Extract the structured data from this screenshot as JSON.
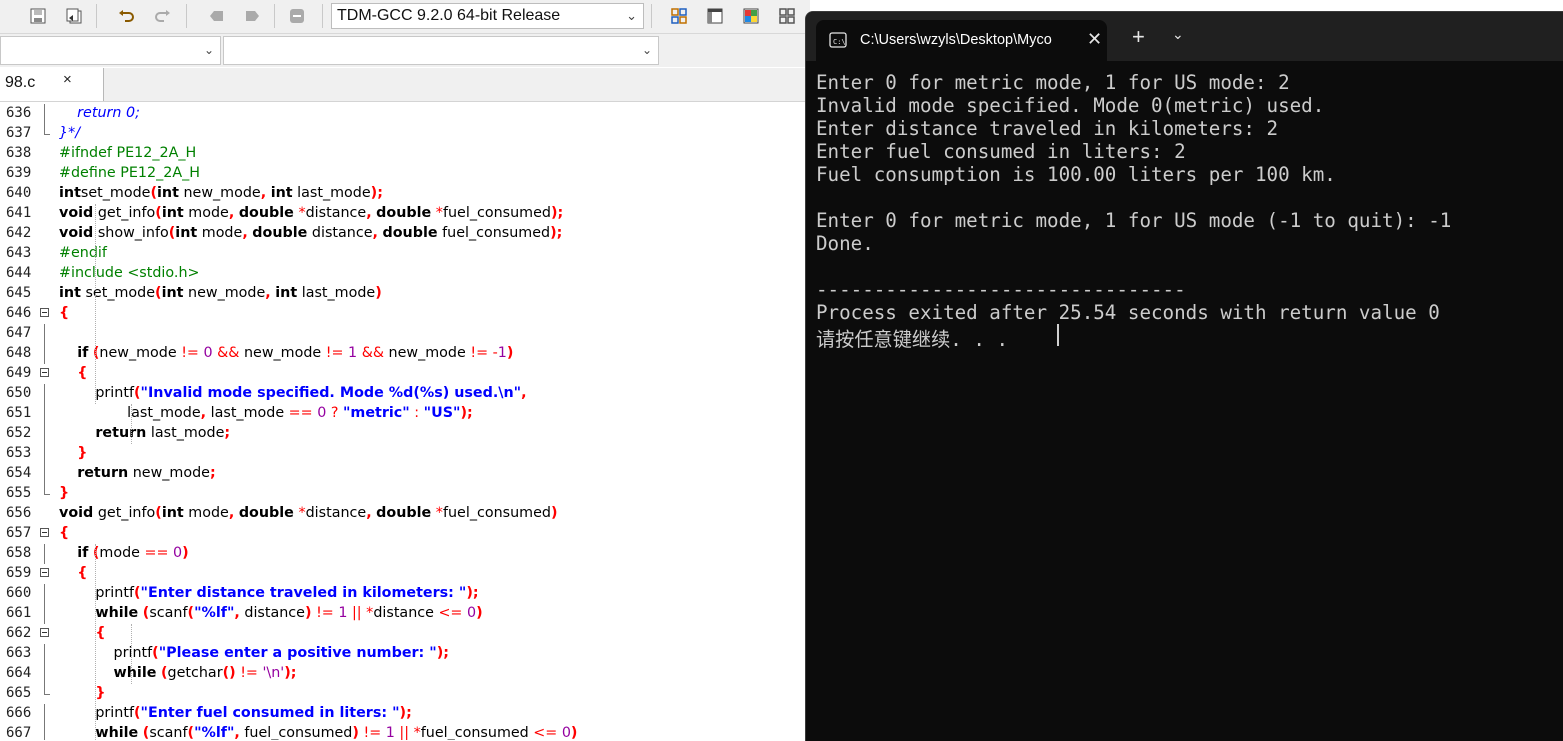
{
  "ide": {
    "compiler": "TDM-GCC 9.2.0 64-bit Release",
    "tab_label": "98.c",
    "tab_close": "×",
    "lines": [
      {
        "n": "636",
        "t": [
          [
            "cm",
            "    return 0;"
          ]
        ]
      },
      {
        "n": "637",
        "t": [
          [
            "cm",
            "}*/"
          ]
        ]
      },
      {
        "n": "638",
        "t": [
          [
            "pp",
            "#ifndef PE12_2A_H"
          ]
        ]
      },
      {
        "n": "639",
        "t": [
          [
            "pp",
            "#define PE12_2A_H"
          ]
        ]
      },
      {
        "n": "640",
        "t": [
          [
            "kw",
            "int"
          ],
          [
            "",
            "set_mode"
          ],
          [
            "sym",
            "("
          ],
          [
            "kw",
            "int"
          ],
          [
            "",
            " new_mode"
          ],
          [
            "sym",
            ","
          ],
          [
            "",
            " "
          ],
          [
            "kw",
            "int"
          ],
          [
            "",
            " last_mode"
          ],
          [
            "sym",
            ");"
          ]
        ]
      },
      {
        "n": "641",
        "t": [
          [
            "kw",
            "void"
          ],
          [
            "",
            " get_info"
          ],
          [
            "sym",
            "("
          ],
          [
            "kw",
            "int"
          ],
          [
            "",
            " mode"
          ],
          [
            "sym",
            ","
          ],
          [
            "",
            " "
          ],
          [
            "kw",
            "double"
          ],
          [
            "",
            " "
          ],
          [
            "op",
            "*"
          ],
          [
            "",
            "distance"
          ],
          [
            "sym",
            ","
          ],
          [
            "",
            " "
          ],
          [
            "kw",
            "double"
          ],
          [
            "",
            " "
          ],
          [
            "op",
            "*"
          ],
          [
            "",
            "fuel_consumed"
          ],
          [
            "sym",
            ");"
          ]
        ]
      },
      {
        "n": "642",
        "t": [
          [
            "kw",
            "void"
          ],
          [
            "",
            " show_info"
          ],
          [
            "sym",
            "("
          ],
          [
            "kw",
            "int"
          ],
          [
            "",
            " mode"
          ],
          [
            "sym",
            ","
          ],
          [
            "",
            " "
          ],
          [
            "kw",
            "double"
          ],
          [
            "",
            " distance"
          ],
          [
            "sym",
            ","
          ],
          [
            "",
            " "
          ],
          [
            "kw",
            "double"
          ],
          [
            "",
            " fuel_consumed"
          ],
          [
            "sym",
            ");"
          ]
        ]
      },
      {
        "n": "643",
        "t": [
          [
            "pp",
            "#endif"
          ]
        ]
      },
      {
        "n": "644",
        "t": [
          [
            "pp",
            "#include <stdio.h>"
          ]
        ]
      },
      {
        "n": "645",
        "t": [
          [
            "kw",
            "int"
          ],
          [
            "",
            " set_mode"
          ],
          [
            "sym",
            "("
          ],
          [
            "kw",
            "int"
          ],
          [
            "",
            " new_mode"
          ],
          [
            "sym",
            ","
          ],
          [
            "",
            " "
          ],
          [
            "kw",
            "int"
          ],
          [
            "",
            " last_mode"
          ],
          [
            "sym",
            ")"
          ]
        ]
      },
      {
        "n": "646",
        "t": [
          [
            "sym",
            "{"
          ]
        ]
      },
      {
        "n": "647",
        "t": []
      },
      {
        "n": "648",
        "t": [
          [
            "",
            "    "
          ],
          [
            "kw",
            "if"
          ],
          [
            "",
            " "
          ],
          [
            "sym",
            "("
          ],
          [
            "",
            "new_mode "
          ],
          [
            "op",
            "!="
          ],
          [
            "",
            " "
          ],
          [
            "num",
            "0"
          ],
          [
            "",
            " "
          ],
          [
            "op",
            "&&"
          ],
          [
            "",
            " new_mode "
          ],
          [
            "op",
            "!="
          ],
          [
            "",
            " "
          ],
          [
            "num",
            "1"
          ],
          [
            "",
            " "
          ],
          [
            "op",
            "&&"
          ],
          [
            "",
            " new_mode "
          ],
          [
            "op",
            "!="
          ],
          [
            "",
            " "
          ],
          [
            "op",
            "-"
          ],
          [
            "num",
            "1"
          ],
          [
            "sym",
            ")"
          ]
        ]
      },
      {
        "n": "649",
        "t": [
          [
            "",
            "    "
          ],
          [
            "sym",
            "{"
          ]
        ]
      },
      {
        "n": "650",
        "t": [
          [
            "",
            "        printf"
          ],
          [
            "sym",
            "("
          ],
          [
            "str",
            "\"Invalid mode specified. Mode %d(%s) used.\\n\""
          ],
          [
            "sym",
            ","
          ]
        ]
      },
      {
        "n": "651",
        "t": [
          [
            "",
            "               last_mode"
          ],
          [
            "sym",
            ","
          ],
          [
            "",
            " last_mode "
          ],
          [
            "op",
            "=="
          ],
          [
            "",
            " "
          ],
          [
            "num",
            "0"
          ],
          [
            "",
            " "
          ],
          [
            "op",
            "?"
          ],
          [
            "",
            " "
          ],
          [
            "str",
            "\"metric\""
          ],
          [
            "",
            " "
          ],
          [
            "op",
            ":"
          ],
          [
            "",
            " "
          ],
          [
            "str",
            "\"US\""
          ],
          [
            "sym",
            ");"
          ]
        ]
      },
      {
        "n": "652",
        "t": [
          [
            "",
            "        "
          ],
          [
            "kw",
            "return"
          ],
          [
            "",
            " last_mode"
          ],
          [
            "sym",
            ";"
          ]
        ]
      },
      {
        "n": "653",
        "t": [
          [
            "",
            "    "
          ],
          [
            "sym",
            "}"
          ]
        ]
      },
      {
        "n": "654",
        "t": [
          [
            "",
            "    "
          ],
          [
            "kw",
            "return"
          ],
          [
            "",
            " new_mode"
          ],
          [
            "sym",
            ";"
          ]
        ]
      },
      {
        "n": "655",
        "t": [
          [
            "sym",
            "}"
          ]
        ]
      },
      {
        "n": "656",
        "t": [
          [
            "kw",
            "void"
          ],
          [
            "",
            " get_info"
          ],
          [
            "sym",
            "("
          ],
          [
            "kw",
            "int"
          ],
          [
            "",
            " mode"
          ],
          [
            "sym",
            ","
          ],
          [
            "",
            " "
          ],
          [
            "kw",
            "double"
          ],
          [
            "",
            " "
          ],
          [
            "op",
            "*"
          ],
          [
            "",
            "distance"
          ],
          [
            "sym",
            ","
          ],
          [
            "",
            " "
          ],
          [
            "kw",
            "double"
          ],
          [
            "",
            " "
          ],
          [
            "op",
            "*"
          ],
          [
            "",
            "fuel_consumed"
          ],
          [
            "sym",
            ")"
          ]
        ]
      },
      {
        "n": "657",
        "t": [
          [
            "sym",
            "{"
          ]
        ]
      },
      {
        "n": "658",
        "t": [
          [
            "",
            "    "
          ],
          [
            "kw",
            "if"
          ],
          [
            "",
            " "
          ],
          [
            "sym",
            "("
          ],
          [
            "",
            "mode "
          ],
          [
            "op",
            "=="
          ],
          [
            "",
            " "
          ],
          [
            "num",
            "0"
          ],
          [
            "sym",
            ")"
          ]
        ]
      },
      {
        "n": "659",
        "t": [
          [
            "",
            "    "
          ],
          [
            "sym",
            "{"
          ]
        ]
      },
      {
        "n": "660",
        "t": [
          [
            "",
            "        printf"
          ],
          [
            "sym",
            "("
          ],
          [
            "str",
            "\"Enter distance traveled in kilometers: \""
          ],
          [
            "sym",
            ");"
          ]
        ]
      },
      {
        "n": "661",
        "t": [
          [
            "",
            "        "
          ],
          [
            "kw",
            "while"
          ],
          [
            "",
            " "
          ],
          [
            "sym",
            "("
          ],
          [
            "",
            "scanf"
          ],
          [
            "sym",
            "("
          ],
          [
            "str",
            "\"%lf\""
          ],
          [
            "sym",
            ","
          ],
          [
            "",
            " distance"
          ],
          [
            "sym",
            ")"
          ],
          [
            "",
            " "
          ],
          [
            "op",
            "!="
          ],
          [
            "",
            " "
          ],
          [
            "num",
            "1"
          ],
          [
            "",
            " "
          ],
          [
            "op",
            "||"
          ],
          [
            "",
            " "
          ],
          [
            "op",
            "*"
          ],
          [
            "",
            "distance "
          ],
          [
            "op",
            "<="
          ],
          [
            "",
            " "
          ],
          [
            "num",
            "0"
          ],
          [
            "sym",
            ")"
          ]
        ]
      },
      {
        "n": "662",
        "t": [
          [
            "",
            "        "
          ],
          [
            "sym",
            "{"
          ]
        ]
      },
      {
        "n": "663",
        "t": [
          [
            "",
            "            printf"
          ],
          [
            "sym",
            "("
          ],
          [
            "str",
            "\"Please enter a positive number: \""
          ],
          [
            "sym",
            ");"
          ]
        ]
      },
      {
        "n": "664",
        "t": [
          [
            "",
            "            "
          ],
          [
            "kw",
            "while"
          ],
          [
            "",
            " "
          ],
          [
            "sym",
            "("
          ],
          [
            "",
            "getchar"
          ],
          [
            "sym",
            "()"
          ],
          [
            "",
            " "
          ],
          [
            "op",
            "!="
          ],
          [
            "",
            " "
          ],
          [
            "num",
            "'\\n'"
          ],
          [
            "sym",
            ");"
          ]
        ]
      },
      {
        "n": "665",
        "t": [
          [
            "",
            "        "
          ],
          [
            "sym",
            "}"
          ]
        ]
      },
      {
        "n": "666",
        "t": [
          [
            "",
            "        printf"
          ],
          [
            "sym",
            "("
          ],
          [
            "str",
            "\"Enter fuel consumed in liters: \""
          ],
          [
            "sym",
            ");"
          ]
        ]
      },
      {
        "n": "667",
        "t": [
          [
            "",
            "        "
          ],
          [
            "kw",
            "while"
          ],
          [
            "",
            " "
          ],
          [
            "sym",
            "("
          ],
          [
            "",
            "scanf"
          ],
          [
            "sym",
            "("
          ],
          [
            "str",
            "\"%lf\""
          ],
          [
            "sym",
            ","
          ],
          [
            "",
            " fuel_consumed"
          ],
          [
            "sym",
            ")"
          ],
          [
            "",
            " "
          ],
          [
            "op",
            "!="
          ],
          [
            "",
            " "
          ],
          [
            "num",
            "1"
          ],
          [
            "",
            " "
          ],
          [
            "op",
            "||"
          ],
          [
            "",
            " "
          ],
          [
            "op",
            "*"
          ],
          [
            "",
            "fuel_consumed "
          ],
          [
            "op",
            "<="
          ],
          [
            "",
            " "
          ],
          [
            "num",
            "0"
          ],
          [
            "sym",
            ")"
          ]
        ]
      }
    ]
  },
  "terminal": {
    "tab_title": "C:\\Users\\wzyls\\Desktop\\Myco",
    "tab_close": "✕",
    "new_tab": "+",
    "dropdown": "⌄",
    "lines": [
      "Enter 0 for metric mode, 1 for US mode: 2",
      "Invalid mode specified. Mode 0(metric) used.",
      "Enter distance traveled in kilometers: 2",
      "Enter fuel consumed in liters: 2",
      "Fuel consumption is 100.00 liters per 100 km.",
      "",
      "Enter 0 for metric mode, 1 for US mode (-1 to quit): -1",
      "Done.",
      "",
      "--------------------------------",
      "Process exited after 25.54 seconds with return value 0",
      "请按任意键继续. . ."
    ]
  }
}
